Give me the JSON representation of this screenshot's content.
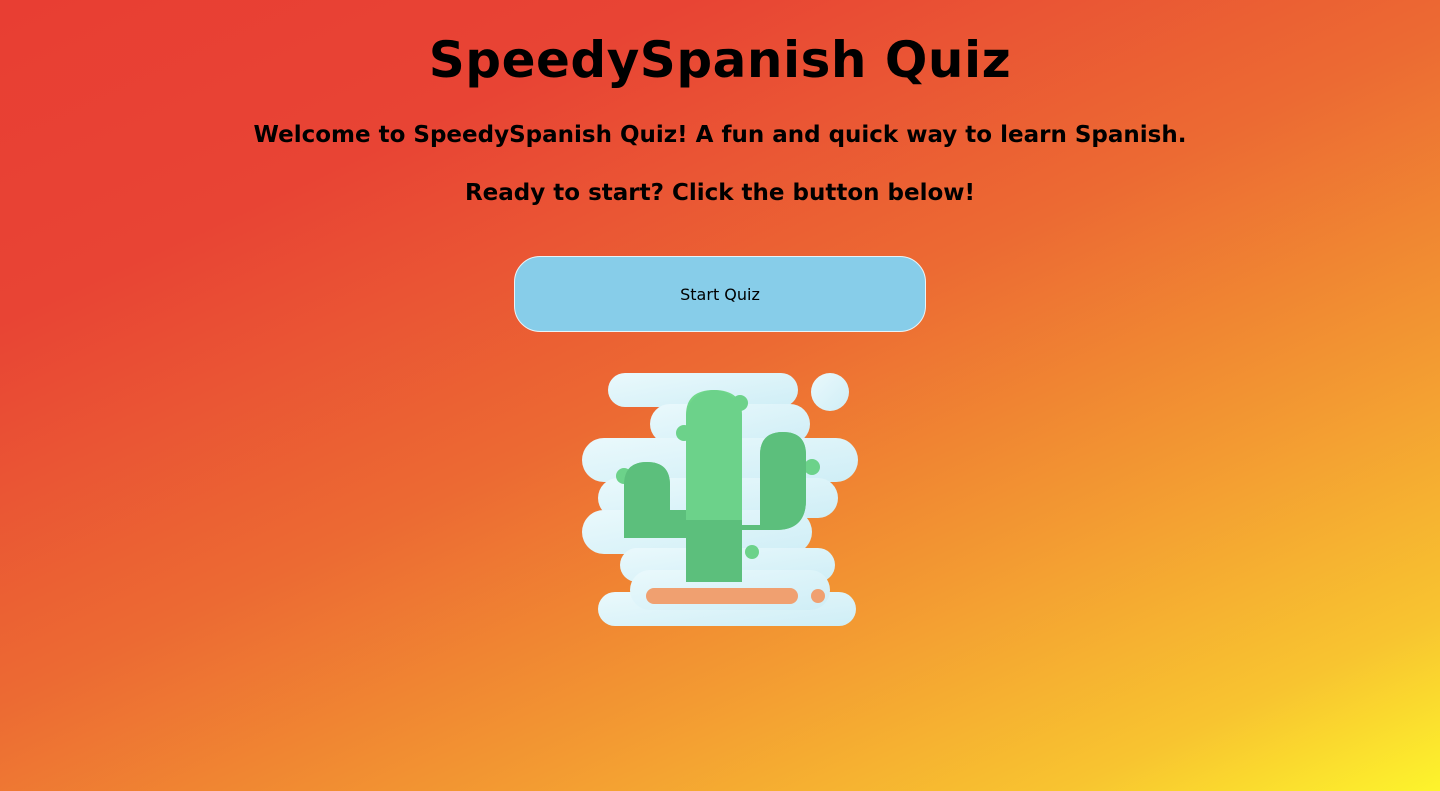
{
  "header": {
    "title": "SpeedySpanish Quiz"
  },
  "main": {
    "welcome_text": "Welcome to SpeedySpanish Quiz! A fun and quick way to learn Spanish.",
    "ready_text": "Ready to start? Click the button below!",
    "start_button_label": "Start Quiz",
    "illustration": "cactus-icon"
  },
  "colors": {
    "background_top": "#e83e33",
    "background_bottom": "#fdf42c",
    "button_fill": "#87cde9",
    "cactus_green": "#5ec57e",
    "cloud": "#dff6fb",
    "pot": "#f0a070"
  }
}
